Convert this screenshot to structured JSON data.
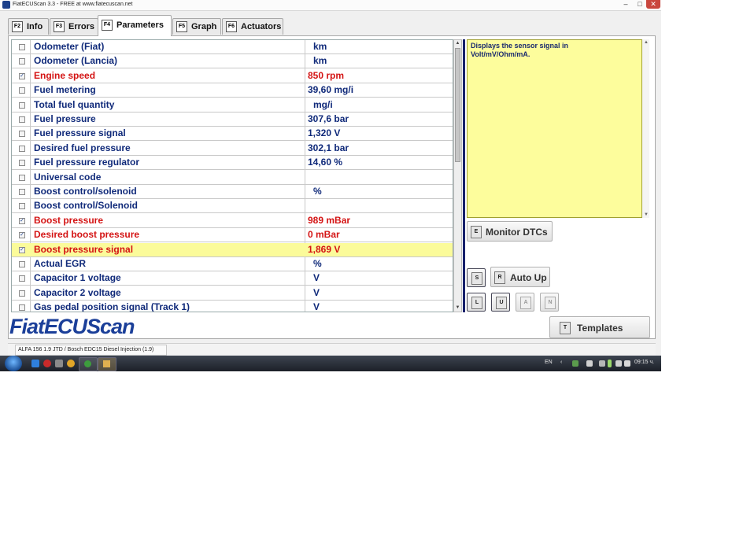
{
  "window": {
    "title": "FiatECUScan 3.3 - FREE at www.fiatecuscan.net",
    "minimize": "–",
    "maximize": "□",
    "close": "✕"
  },
  "tabs": [
    {
      "key": "F2",
      "label": "Info"
    },
    {
      "key": "F3",
      "label": "Errors"
    },
    {
      "key": "F4",
      "label": "Parameters"
    },
    {
      "key": "F5",
      "label": "Graph"
    },
    {
      "key": "F6",
      "label": "Actuators"
    }
  ],
  "active_tab": "Parameters",
  "parameters": [
    {
      "name": "Odometer (Fiat)",
      "value": "km",
      "checked": false
    },
    {
      "name": "Odometer (Lancia)",
      "value": "km",
      "checked": false
    },
    {
      "name": "Engine speed",
      "value": "850 rpm",
      "checked": true
    },
    {
      "name": "Fuel metering",
      "value": "39,60 mg/i",
      "checked": false
    },
    {
      "name": "Total fuel quantity",
      "value": "mg/i",
      "checked": false
    },
    {
      "name": "Fuel pressure",
      "value": "307,6 bar",
      "checked": false
    },
    {
      "name": "Fuel pressure signal",
      "value": "1,320 V",
      "checked": false
    },
    {
      "name": "Desired fuel pressure",
      "value": "302,1 bar",
      "checked": false
    },
    {
      "name": "Fuel pressure regulator",
      "value": "14,60 %",
      "checked": false
    },
    {
      "name": "Universal code",
      "value": "",
      "checked": false
    },
    {
      "name": "Boost control/solenoid",
      "value": "%",
      "checked": false
    },
    {
      "name": "Boost control/Solenoid",
      "value": "",
      "checked": false
    },
    {
      "name": "Boost pressure",
      "value": "989 mBar",
      "checked": true
    },
    {
      "name": "Desired boost pressure",
      "value": "0 mBar",
      "checked": true
    },
    {
      "name": "Boost pressure signal",
      "value": "1,869 V",
      "checked": true,
      "highlighted": true
    },
    {
      "name": "Actual EGR",
      "value": "%",
      "checked": false
    },
    {
      "name": "Capacitor 1 voltage",
      "value": "V",
      "checked": false
    },
    {
      "name": "Capacitor 2 voltage",
      "value": "V",
      "checked": false
    },
    {
      "name": "Gas pedal position signal (Track 1)",
      "value": "V",
      "checked": false
    }
  ],
  "help_text": "Displays the sensor signal in Volt/mV/Ohm/mA.",
  "buttons": {
    "monitor_dtcs": {
      "key": "E",
      "label": "Monitor DTCs"
    },
    "s": {
      "key": "S"
    },
    "auto_up": {
      "key": "R",
      "label": "Auto Up"
    },
    "l": {
      "key": "L"
    },
    "u": {
      "key": "U"
    },
    "a": {
      "key": "A"
    },
    "n": {
      "key": "N"
    },
    "templates": {
      "key": "T",
      "label": "Templates"
    }
  },
  "logo_text": "FiatECUScan",
  "status": "ALFA 156 1.9 JTD / Bosch EDC15 Diesel Injection (1.9)",
  "taskbar": {
    "language": "EN",
    "time": "09:15 ч."
  },
  "colors": {
    "param_text": "#102a7a",
    "active_param_text": "#d41414",
    "highlight_row": "#fbfb9a",
    "help_bg": "#fdfd9c",
    "logo": "#1b3f99"
  }
}
